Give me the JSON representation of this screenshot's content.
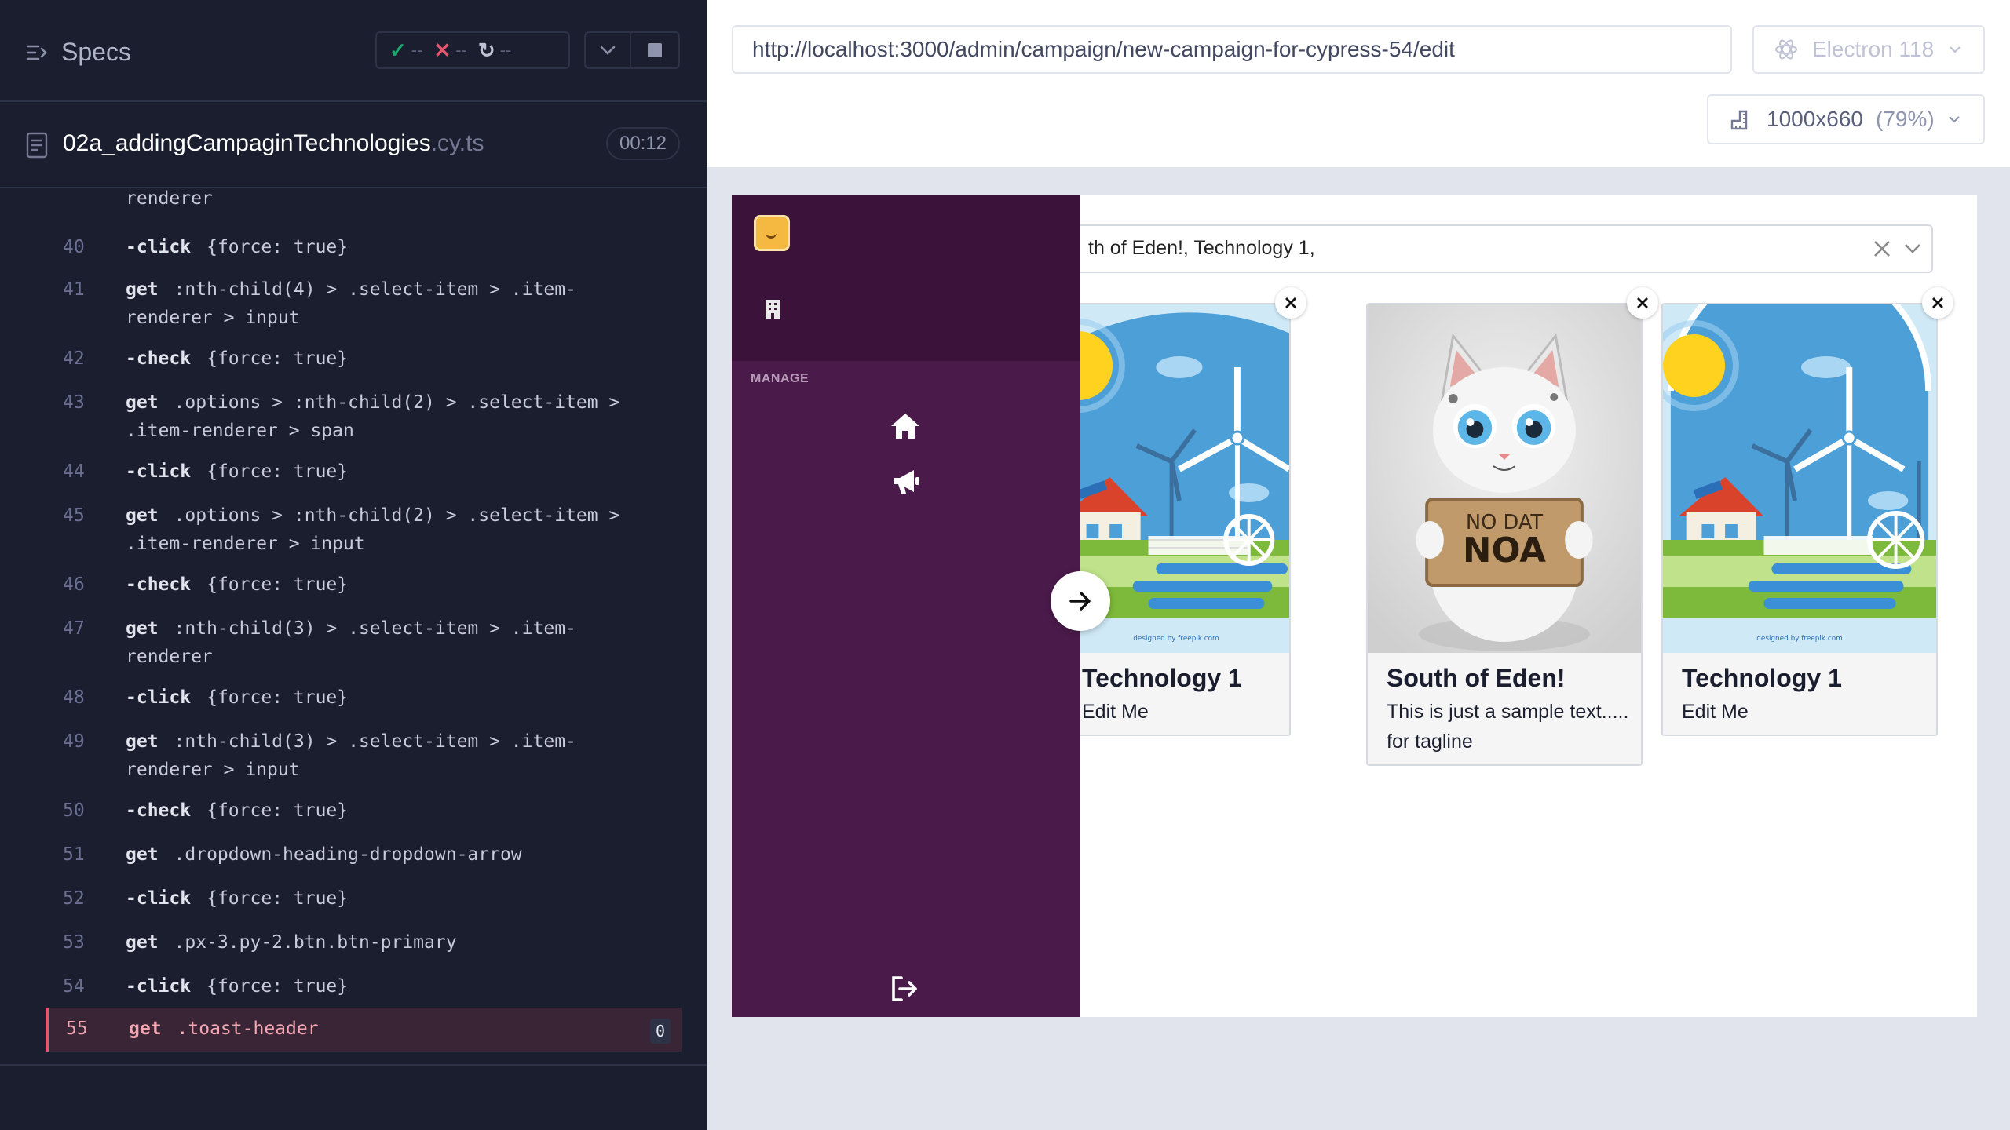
{
  "header": {
    "specs_label": "Specs",
    "stats": {
      "passed": "--",
      "failed": "--",
      "pending": "--"
    }
  },
  "spec": {
    "file_base": "02a_addingCampaginTechnologies",
    "file_ext": ".cy.ts",
    "duration": "00:12"
  },
  "log": {
    "partial_top": "renderer",
    "lines": [
      {
        "num": "40",
        "cmd": "-click",
        "arg": "{force: true}"
      },
      {
        "num": "41",
        "cmd": "get",
        "arg": ":nth-child(4) > .select-item > .item-",
        "arg2": "renderer > input"
      },
      {
        "num": "42",
        "cmd": "-check",
        "arg": "{force: true}"
      },
      {
        "num": "43",
        "cmd": "get",
        "arg": ".options > :nth-child(2) > .select-item >",
        "arg2": ".item-renderer > span"
      },
      {
        "num": "44",
        "cmd": "-click",
        "arg": "{force: true}"
      },
      {
        "num": "45",
        "cmd": "get",
        "arg": ".options > :nth-child(2) > .select-item >",
        "arg2": ".item-renderer > input"
      },
      {
        "num": "46",
        "cmd": "-check",
        "arg": "{force: true}"
      },
      {
        "num": "47",
        "cmd": "get",
        "arg": ":nth-child(3) > .select-item > .item-",
        "arg2": "renderer"
      },
      {
        "num": "48",
        "cmd": "-click",
        "arg": "{force: true}"
      },
      {
        "num": "49",
        "cmd": "get",
        "arg": ":nth-child(3) > .select-item > .item-",
        "arg2": "renderer > input"
      },
      {
        "num": "50",
        "cmd": "-check",
        "arg": "{force: true}"
      },
      {
        "num": "51",
        "cmd": "get",
        "arg": ".dropdown-heading-dropdown-arrow"
      },
      {
        "num": "52",
        "cmd": "-click",
        "arg": "{force: true}"
      },
      {
        "num": "53",
        "cmd": "get",
        "arg": ".px-3.py-2.btn.btn-primary"
      },
      {
        "num": "54",
        "cmd": "-click",
        "arg": "{force: true}"
      },
      {
        "num": "55",
        "cmd": "get",
        "arg": ".toast-header",
        "count": "0"
      }
    ]
  },
  "aut": {
    "url": "http://localhost:3000/admin/campaign/new-campaign-for-cypress-54/edit",
    "browser": "Electron 118",
    "viewport": "1000x660",
    "zoom": "(79%)"
  },
  "app": {
    "manage_label": "MANAGE",
    "select_value": "th of Eden!, Technology 1,",
    "cards": [
      {
        "title": "Technology 1",
        "subtitle": "Edit Me"
      },
      {
        "title": "South of Eden!",
        "subtitle": "This is just a sample text..... for tagline",
        "sign_line1": "NO DAT",
        "sign_line2": "NOA"
      },
      {
        "title": "Technology 1",
        "subtitle": "Edit Me"
      }
    ],
    "image_credit": "designed by freepik.com"
  },
  "colors": {
    "panel_bg": "#1b1e2e",
    "active_line": "#3a2536",
    "sidebar": "#4a1a4a",
    "pass": "#1fa971",
    "fail": "#e45770"
  }
}
